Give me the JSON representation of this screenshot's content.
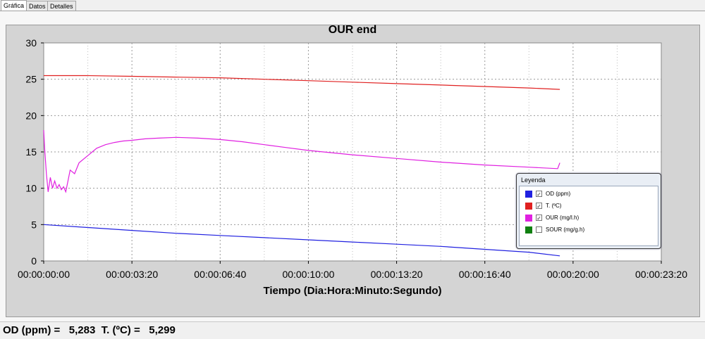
{
  "tabs": [
    {
      "label": "Gráfica",
      "active": true
    },
    {
      "label": "Datos",
      "active": false
    },
    {
      "label": "Detalles",
      "active": false
    }
  ],
  "chart_data": {
    "type": "line",
    "title": "OUR end",
    "xlabel": "Tiempo (Dia:Hora:Minuto:Segundo)",
    "ylabel": "",
    "ylim": [
      0,
      30
    ],
    "xlim_seconds": [
      0,
      1400
    ],
    "xticks": [
      "00:00:00:00",
      "00:00:03:20",
      "00:00:06:40",
      "00:00:10:00",
      "00:00:13:20",
      "00:00:16:40",
      "00:00:20:00",
      "00:00:23:20"
    ],
    "yticks": [
      0,
      5,
      10,
      15,
      20,
      25,
      30
    ],
    "grid": true,
    "legend_position": "bottom-right",
    "series": [
      {
        "name": "OD (ppm)",
        "color": "#2020e0",
        "checked": true,
        "x": [
          0,
          100,
          200,
          300,
          400,
          500,
          600,
          700,
          800,
          900,
          1000,
          1100,
          1170
        ],
        "y": [
          5.0,
          4.6,
          4.2,
          3.8,
          3.5,
          3.2,
          2.9,
          2.6,
          2.3,
          2.0,
          1.6,
          1.2,
          0.7
        ]
      },
      {
        "name": "T. (ºC)",
        "color": "#e02020",
        "checked": true,
        "x": [
          0,
          100,
          200,
          300,
          400,
          500,
          600,
          700,
          800,
          900,
          1000,
          1100,
          1170
        ],
        "y": [
          25.5,
          25.5,
          25.4,
          25.3,
          25.2,
          25.0,
          24.8,
          24.6,
          24.4,
          24.2,
          24.0,
          23.8,
          23.6
        ]
      },
      {
        "name": "OUR (mg/l.h)",
        "color": "#e020e0",
        "checked": true,
        "x": [
          0,
          2,
          6,
          10,
          15,
          20,
          25,
          30,
          35,
          40,
          45,
          50,
          60,
          70,
          80,
          100,
          120,
          140,
          160,
          180,
          200,
          230,
          260,
          300,
          350,
          400,
          450,
          500,
          550,
          600,
          700,
          800,
          900,
          1000,
          1100,
          1165,
          1170
        ],
        "y": [
          18.0,
          15.5,
          12.0,
          9.5,
          11.5,
          10.0,
          11.0,
          10.0,
          10.5,
          9.8,
          10.2,
          9.5,
          12.5,
          12.0,
          13.5,
          14.5,
          15.5,
          16.0,
          16.3,
          16.5,
          16.6,
          16.8,
          16.9,
          17.0,
          16.9,
          16.7,
          16.4,
          16.0,
          15.6,
          15.2,
          14.6,
          14.1,
          13.6,
          13.2,
          12.9,
          12.7,
          13.5
        ]
      },
      {
        "name": "SOUR (mg/g.h)",
        "color": "#108010",
        "checked": false,
        "x": [],
        "y": []
      }
    ]
  },
  "legend": {
    "title": "Leyenda"
  },
  "status": {
    "od_label": "OD (ppm) =",
    "od_value": "5,283",
    "t_label": "T. (ºC) =",
    "t_value": "5,299"
  }
}
